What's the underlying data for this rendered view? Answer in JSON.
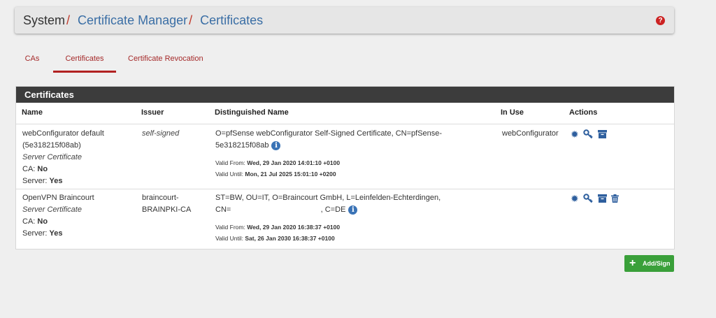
{
  "breadcrumb": {
    "root": "System",
    "sep1": "/",
    "manager": "Certificate Manager",
    "sep2": "/",
    "current": "Certificates"
  },
  "help_icon": "question-circle-icon",
  "tabs": [
    {
      "label": "CAs",
      "active": false
    },
    {
      "label": "Certificates",
      "active": true
    },
    {
      "label": "Certificate Revocation",
      "active": false
    }
  ],
  "panel": {
    "title": "Certificates",
    "columns": [
      "Name",
      "Issuer",
      "Distinguished Name",
      "In Use",
      "Actions"
    ]
  },
  "rows": [
    {
      "name_line1": "webConfigurator default",
      "name_line2": "(5e318215f08ab)",
      "cert_type": "Server Certificate",
      "ca_label": "CA:",
      "ca_value": "No",
      "server_label": "Server:",
      "server_value": "Yes",
      "issuer_line1": "self-signed",
      "issuer_line2": "",
      "dn_line1": "O=pfSense webConfigurator Self-Signed Certificate, CN=pfSense-",
      "dn_line2": "5e318215f08ab",
      "valid_from_label": "Valid From:",
      "valid_from": "Wed, 29 Jan 2020 14:01:10 +0100",
      "valid_until_label": "Valid Until:",
      "valid_until": "Mon, 21 Jul 2025 15:01:10 +0200",
      "in_use": "webConfigurator",
      "actions": [
        "gear-icon",
        "key-icon",
        "archive-icon"
      ]
    },
    {
      "name_line1": "OpenVPN Braincourt",
      "name_line2": "",
      "cert_type": "Server Certificate",
      "ca_label": "CA:",
      "ca_value": "No",
      "server_label": "Server:",
      "server_value": "Yes",
      "issuer_line1": "braincourt-",
      "issuer_line2": "BRAINPKI-CA",
      "dn_line1": "ST=BW, OU=IT, O=Braincourt GmbH, L=Leinfelden-Echterdingen,",
      "dn_line2": "CN=                                          , C=DE",
      "valid_from_label": "Valid From:",
      "valid_from": "Wed, 29 Jan 2020 16:38:37 +0100",
      "valid_until_label": "Valid Until:",
      "valid_until": "Sat, 26 Jan 2030 16:38:37 +0100",
      "in_use": "",
      "actions": [
        "gear-icon",
        "key-icon",
        "archive-icon",
        "trash-icon"
      ]
    }
  ],
  "add_button": {
    "plus": "+",
    "label": "Add/Sign"
  },
  "colors": {
    "accent": "#b22222",
    "link": "#3a6ea5",
    "panel_header": "#3c3c3c",
    "success": "#3aa03a",
    "icon_blue": "#2e5f9e"
  }
}
